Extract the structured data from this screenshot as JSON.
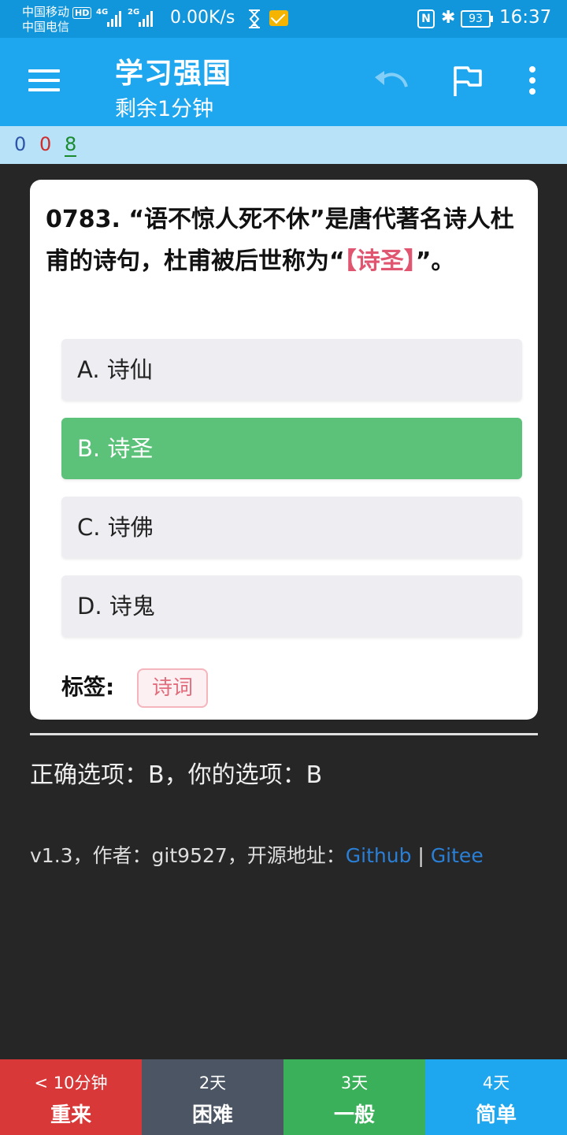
{
  "status_bar": {
    "carrier1": "中国移动",
    "hd": "HD",
    "carrier2": "中国电信",
    "net1": "4G",
    "net2": "2G",
    "net_speed": "0.00K/s",
    "nfc": "N",
    "bluetooth": "✱",
    "battery": "93",
    "time": "16:37",
    "icons": [
      "signal-icon",
      "hourglass-icon",
      "mail-icon",
      "nfc-icon",
      "bluetooth-icon",
      "battery-icon"
    ]
  },
  "app_bar": {
    "title": "学习强国",
    "subtitle": "剩余1分钟",
    "icons": [
      "menu-icon",
      "undo-icon",
      "flag-icon",
      "more-icon"
    ]
  },
  "counters": {
    "blue": "0",
    "red": "0",
    "green": "8"
  },
  "question": {
    "text_before": "0783. “语不惊人死不休”是唐代著名诗人杜甫的诗句，杜甫被后世称为“",
    "answer": "【诗圣】",
    "text_after": "”。",
    "options": [
      {
        "label": "A. 诗仙",
        "selected": false
      },
      {
        "label": "B. 诗圣",
        "selected": true
      },
      {
        "label": "C. 诗佛",
        "selected": false
      },
      {
        "label": "D. 诗鬼",
        "selected": false
      }
    ],
    "tag_label": "标签:",
    "tag": "诗词"
  },
  "result": "正确选项：B，你的选项：B",
  "footer": {
    "prefix": "v1.3，作者：git9527，开源地址：",
    "github": "Github",
    "sep": " | ",
    "gitee": "Gitee"
  },
  "grade_buttons": [
    {
      "interval": "< 10分钟",
      "label": "重来"
    },
    {
      "interval": "2天",
      "label": "困难"
    },
    {
      "interval": "3天",
      "label": "一般"
    },
    {
      "interval": "4天",
      "label": "简单"
    }
  ],
  "colors": {
    "status_bar": "#1296db",
    "app_bar": "#1ea7ef",
    "counter_bar": "#b8e2f8",
    "correct": "#5cc27a",
    "answer_highlight": "#e0556f",
    "again": "#d93838",
    "hard": "#4b5563",
    "good": "#3bb05a",
    "easy": "#1ea7ef"
  }
}
